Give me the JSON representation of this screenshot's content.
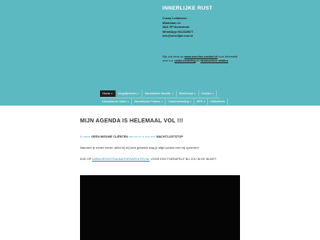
{
  "site": {
    "title": "INNERLIJKE RUST"
  },
  "contact": {
    "lines": [
      "Conny Lubbersen",
      "Middelaan 14",
      "3811 PP Heemstede",
      "WhatsApp 0612345677",
      "info@innerlijke-rust.nl"
    ]
  },
  "note": {
    "text_before": "Kijk ook eens op ",
    "link1": "www.zzorcise-contact.nl",
    "text_mid": " voor informatie over o.a. ",
    "link2": "zuiderverdeling",
    "text_and": " en ",
    "link3": "destructieve relaties"
  },
  "nav": {
    "row1": [
      {
        "label": "Home",
        "chevron": true,
        "active": true
      },
      {
        "label": "Mogelijkheden",
        "chevron": true,
        "active": false
      },
      {
        "label": "Narcistische Moeder",
        "chevron": true,
        "active": false
      },
      {
        "label": "Workshops",
        "chevron": true,
        "active": false
      },
      {
        "label": "Contact",
        "chevron": true,
        "active": false
      }
    ],
    "row2": [
      {
        "label": "Narcistische Vader",
        "chevron": true
      },
      {
        "label": "Narcistische Partner",
        "chevron": true
      },
      {
        "label": "Ouderverstoting",
        "chevron": true
      },
      {
        "label": "NPS",
        "chevron": true
      },
      {
        "label": "Bibliotheek",
        "chevron": false
      }
    ]
  },
  "main": {
    "title": "MIJN AGENDA IS HELEMAAL VOL !!!",
    "p1": {
      "pre": "Ik neem ",
      "bold1": "GEEN NIEUWE CLIËNTEN",
      "mid": " aan en er is ook een ",
      "bold2": "WACHTLIJSTSTOP"
    },
    "p2": "Wanneer je echter eerder cliënt bij mij bent geweest mag je altijd contact met mij opnemen!",
    "p3": {
      "pre": "KIJK OP ",
      "link": "WWW.ZEVGSTRAUMATHERAPEUTEN.NL",
      "post": " VOOR EEN THERAPEUT BIJ JOU IN DE BUURT."
    }
  },
  "colors": {
    "header_bg": "#5db9c1",
    "video_bg": "#050505",
    "nav_active": "#1f1f1f"
  }
}
